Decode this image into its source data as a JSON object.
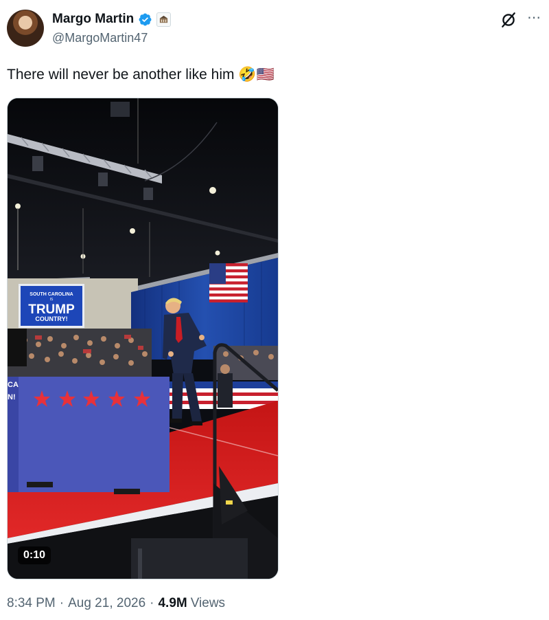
{
  "author": {
    "name": "Margo Martin",
    "handle": "@MargoMartin47",
    "verified_icon": "verified-badge-icon",
    "affiliate_icon": "white-house-seal-icon"
  },
  "tweet": {
    "text": "There will never be another like him 🤣🇺🇸"
  },
  "media": {
    "type": "video",
    "duration": "0:10",
    "banner_text": {
      "line1": "SOUTH CAROLINA",
      "line2": "IS",
      "line3": "TRUMP",
      "line4": "COUNTRY!"
    },
    "edge_text": "CA\nN!"
  },
  "meta": {
    "time": "8:34 PM",
    "date": "Aug 21, 2026",
    "views_count": "4.9M",
    "views_label": "Views"
  },
  "colors": {
    "text": "#0f1419",
    "secondary": "#536471",
    "verified": "#1d9bf0",
    "stage_red": "#d42020",
    "backdrop_blue": "#1e3f9a"
  }
}
